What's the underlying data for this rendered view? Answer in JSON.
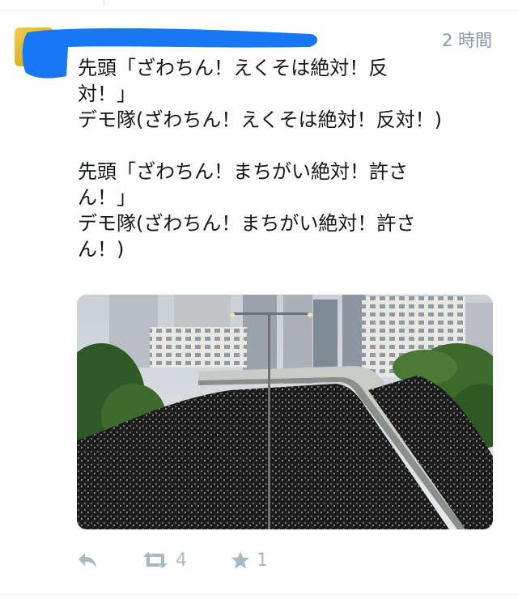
{
  "tweet": {
    "timestamp": "2 時間",
    "text": "先頭「ざわちん！えくそは絶対！反\n対！」\nデモ隊(ざわちん！えくそは絶対！反対！)\n\n先頭「ざわちん！まちがい絶対！許さ\nん！」\nデモ隊(ざわちん！まちがい絶対！許さ\nん！)",
    "media_icon": "protest-crowd-photo",
    "redaction_color": "#1877f2"
  },
  "actions": {
    "reply_icon": "reply-icon",
    "retweet_icon": "retweet-icon",
    "retweet_count": "4",
    "favorite_icon": "star-icon",
    "favorite_count": "1",
    "icon_color": "#aab8c2"
  }
}
